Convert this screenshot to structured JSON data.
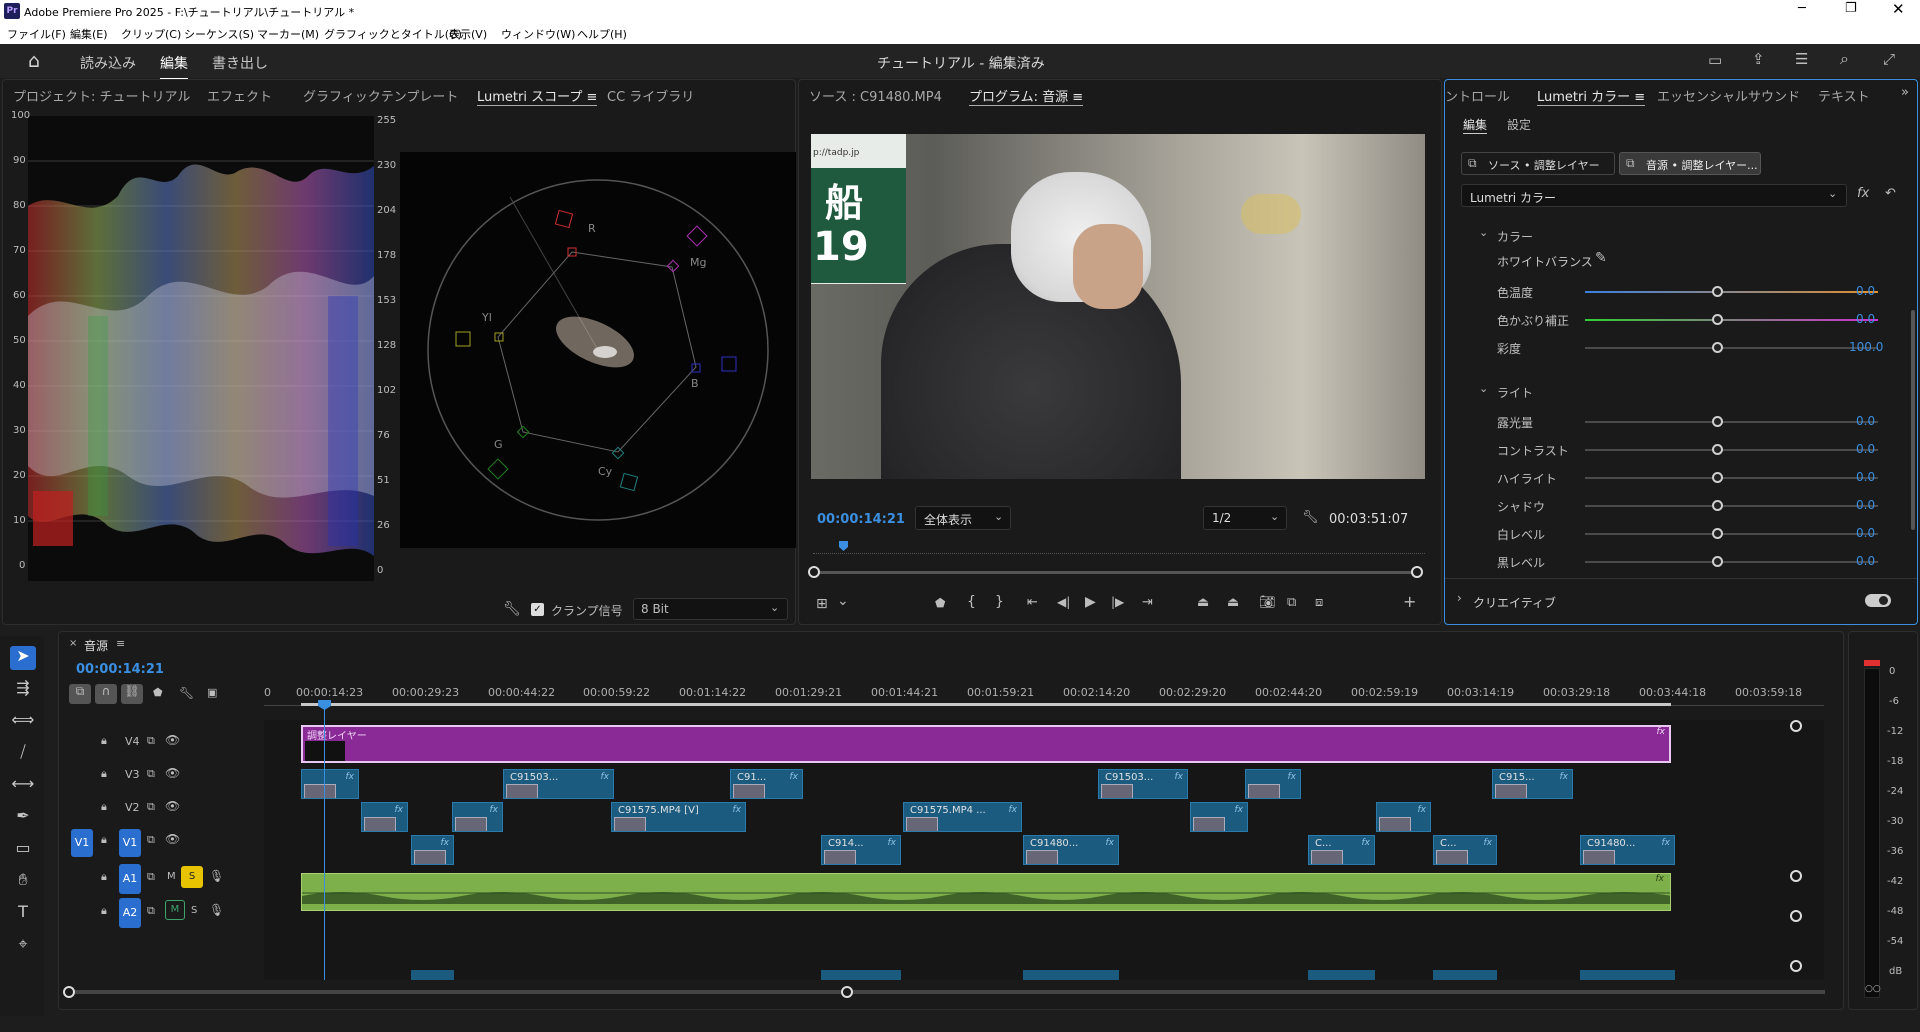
{
  "app": {
    "title": "Adobe Premiere Pro 2025 - F:\\チュートリアル\\チュートリアル *",
    "icon": "Pr"
  },
  "menu": [
    "ファイル(F)",
    "編集(E)",
    "クリップ(C)",
    "シーケンス(S)",
    "マーカー(M)",
    "グラフィックとタイトル(G)",
    "表示(V)",
    "ウィンドウ(W)",
    "ヘルプ(H)"
  ],
  "workspace": {
    "tabs": [
      "読み込み",
      "編集",
      "書き出し"
    ],
    "active": "編集",
    "center_title": "チュートリアル - 編集済み"
  },
  "left_panel": {
    "tabs": [
      "プロジェクト: チュートリアル",
      "エフェクト",
      "グラフィックテンプレート",
      "Lumetri スコープ ≡",
      "CC ライブラリ"
    ],
    "active": "Lumetri スコープ ≡",
    "parade_left_ticks": [
      "100",
      "90",
      "80",
      "70",
      "60",
      "50",
      "40",
      "30",
      "20",
      "10",
      "0"
    ],
    "parade_right_ticks": [
      "255",
      "230",
      "204",
      "178",
      "153",
      "128",
      "102",
      "76",
      "51",
      "26",
      "0"
    ],
    "vectorscope_labels": [
      "R",
      "Mg",
      "B",
      "Cy",
      "G",
      "Yl"
    ],
    "clamp_label": "クランプ信号",
    "clamp_checked": true,
    "bit_select": "8 Bit"
  },
  "program_panel": {
    "tabs": [
      "ソース : C91480.MP4",
      "プログラム: 音源 ≡"
    ],
    "active": "プログラム: 音源 ≡",
    "timecode": "00:00:14:21",
    "zoom": "全体表示",
    "resolution": "1/2",
    "duration": "00:03:51:07",
    "sign_text": "船",
    "sign_number": "19",
    "sign_url": "p://tadp.jp"
  },
  "right_panel": {
    "tabs": [
      "ントロール",
      "Lumetri カラー ≡",
      "エッセンシャルサウンド",
      "テキスト"
    ],
    "active": "Lumetri カラー ≡",
    "subtabs": [
      "編集",
      "設定"
    ],
    "source_btn": "ソース • 調整レイヤー",
    "target_btn": "音源 • 調整レイヤー...",
    "effect_select": "Lumetri カラー",
    "color_section": "カラー",
    "wb_label": "ホワイトバランス",
    "color_rows": [
      {
        "label": "色温度",
        "value": "0.0"
      },
      {
        "label": "色かぶり補正",
        "value": "0.0"
      },
      {
        "label": "彩度",
        "value": "100.0"
      }
    ],
    "light_section": "ライト",
    "light_rows": [
      {
        "label": "露光量",
        "value": "0.0"
      },
      {
        "label": "コントラスト",
        "value": "0.0"
      },
      {
        "label": "ハイライト",
        "value": "0.0"
      },
      {
        "label": "シャドウ",
        "value": "0.0"
      },
      {
        "label": "白レベル",
        "value": "0.0"
      },
      {
        "label": "黒レベル",
        "value": "0.0"
      }
    ],
    "creative_section": "クリエイティブ"
  },
  "timeline": {
    "sequence_name": "音源",
    "timecode": "00:00:14:21",
    "ruler": [
      "0",
      "00:00:14:23",
      "00:00:29:23",
      "00:00:44:22",
      "00:00:59:22",
      "00:01:14:22",
      "00:01:29:21",
      "00:01:44:21",
      "00:01:59:21",
      "00:02:14:20",
      "00:02:29:20",
      "00:02:44:20",
      "00:02:59:19",
      "00:03:14:19",
      "00:03:29:18",
      "00:03:44:18",
      "00:03:59:18"
    ],
    "tracks": [
      "V4",
      "V3",
      "V2",
      "V1",
      "A1",
      "A2"
    ],
    "source_patch": "V1",
    "adjust_layer_name": "調整レイヤー",
    "v3_clips": [
      "",
      "C91503...",
      "C91...",
      "C91503...",
      "",
      "C915..."
    ],
    "v2_clips": [
      "",
      "",
      "C91575.MP4 [V]",
      "C91575.MP4 ...",
      "",
      ""
    ],
    "v1_clips": [
      "",
      "C914...",
      "C91480...",
      "C...",
      "C...",
      "C91480..."
    ],
    "m_label": "M",
    "s_label": "S"
  },
  "meter": {
    "ticks": [
      "0",
      "-6",
      "-12",
      "-18",
      "-24",
      "-30",
      "-36",
      "-42",
      "-48",
      "-54"
    ],
    "unit": "dB"
  },
  "colors": {
    "accent": "#3b8fe0",
    "adjust_layer": "#8a2a96",
    "clip": "#1b5b80",
    "audio": "#7db04a",
    "solo": "#e8c400"
  }
}
